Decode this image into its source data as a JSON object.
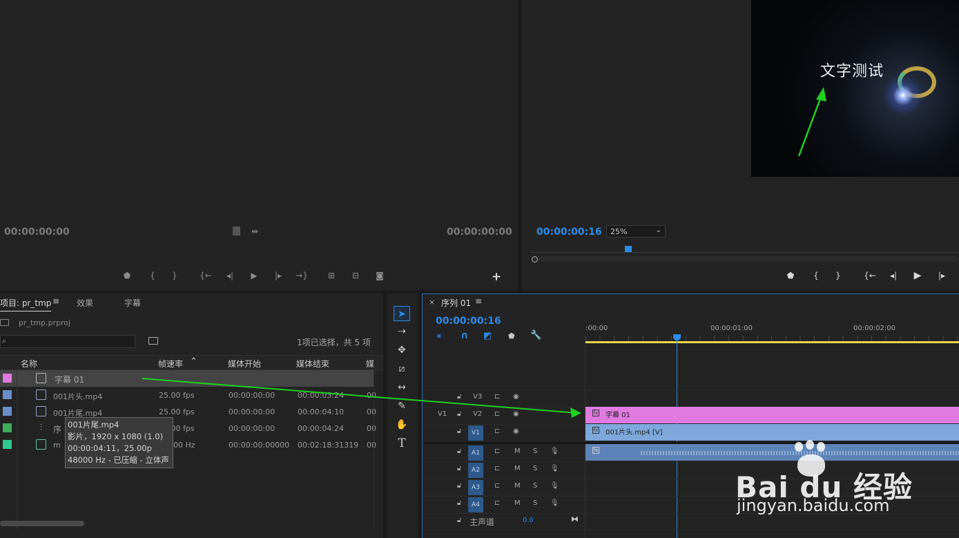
{
  "source_monitor": {
    "timecode_left": "00:00:00:00",
    "timecode_right": "00:00:00:00"
  },
  "program_monitor": {
    "timecode": "00:00:00:16",
    "zoom": "25%",
    "preview_text": "文字测试"
  },
  "project_panel": {
    "tabs": [
      "项目: pr_tmp",
      "效果",
      "字幕"
    ],
    "project_file": "pr_tmp.prproj",
    "search_placeholder": "",
    "selection_info": "1项已选择，共 5 项",
    "columns": [
      "名称",
      "帧速率",
      "媒体开始",
      "媒体结束",
      "媒"
    ],
    "items": [
      {
        "name": "字幕 01",
        "fps": "",
        "start": "",
        "end": "",
        "extra": "",
        "color": "#e07ae0"
      },
      {
        "name": "001片头.mp4",
        "fps": "25.00 fps",
        "start": "00:00:00:00",
        "end": "00:00:03:24",
        "extra": "00",
        "color": "#6a8fc8"
      },
      {
        "name": "001片尾.mp4",
        "fps": "25.00 fps",
        "start": "00:00:00:00",
        "end": "00:00:04:10",
        "extra": "00",
        "color": "#6a8fc8"
      },
      {
        "name": "序",
        "fps": "25.00 fps",
        "start": "00:00:00:00",
        "end": "00:00:04:24",
        "extra": "00",
        "color": "#3fae5a"
      },
      {
        "name": "m",
        "fps": "48000 Hz",
        "start": "00:00:00:00000",
        "end": "00:02:18:31319",
        "extra": "00",
        "color": "#2ec893"
      }
    ],
    "tooltip": [
      "001片尾.mp4",
      "影片，1920 x 1080 (1.0)",
      "00:00:04:11，25.00p",
      "48000 Hz - 已压缩 - 立体声"
    ]
  },
  "timeline": {
    "sequence_name": "序列 01",
    "timecode": "00:00:00:16",
    "ruler_labels": [
      ":00:00",
      "00:00:01:00",
      "00:00:02:00"
    ],
    "video_tracks": [
      {
        "label": "V3",
        "source": ""
      },
      {
        "label": "V2",
        "source": "V1"
      },
      {
        "label": "V1",
        "source": ""
      }
    ],
    "audio_tracks": [
      "A1",
      "A2",
      "A3",
      "A4"
    ],
    "mute_label": "M",
    "solo_label": "S",
    "master_label": "主声道",
    "master_value": "0.0",
    "clips": {
      "title_clip": "字幕 01",
      "video_clip": "001片头.mp4 [V]"
    }
  },
  "watermark": {
    "brand": "Bai du 经验",
    "url": "jingyan.baidu.com"
  },
  "colors": {
    "accent_blue": "#2d8ceb",
    "title_clip": "#e07ae0",
    "video_clip": "#7ea8dc",
    "work_area": "#e6d84a",
    "arrow": "#1fd11f"
  }
}
